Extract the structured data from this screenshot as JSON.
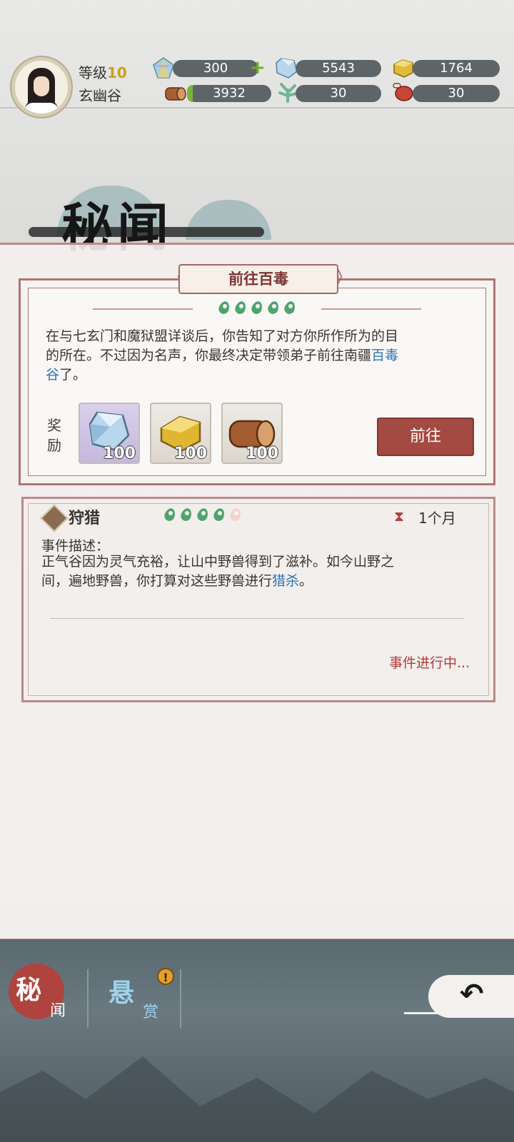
{
  "player": {
    "level_label": "等级",
    "level_value": "10",
    "sect_name": "玄幽谷"
  },
  "resources": [
    {
      "id": "spirit-stone",
      "icon": "rainbow-crystal-icon",
      "value": "300",
      "has_plus": true
    },
    {
      "id": "ore",
      "icon": "blue-ore-icon",
      "value": "5543"
    },
    {
      "id": "gold",
      "icon": "gold-ingot-icon",
      "value": "1764"
    },
    {
      "id": "wood",
      "icon": "wood-log-icon",
      "value": "3932",
      "fill_ratio": 0.05
    },
    {
      "id": "herb",
      "icon": "green-herb-icon",
      "value": "30"
    },
    {
      "id": "meat",
      "icon": "meat-icon",
      "value": "30"
    }
  ],
  "page": {
    "title": "秘闻"
  },
  "quest": {
    "title": "前往百毒",
    "rating": 5,
    "rating_max": 5,
    "desc_line1": "在与七玄门和魔狱盟详谈后，你告知了对方你所作所为的目",
    "desc_line2_a": "的所在。不过因为名声，你最终决定带领弟子前往南疆",
    "desc_line2_hl": "百毒",
    "desc_line3_hl": "谷",
    "desc_line3_b": "了。",
    "reward_label": "奖励",
    "rewards": [
      {
        "icon": "blue-ore-icon",
        "count": "100"
      },
      {
        "icon": "gold-ingot-icon",
        "count": "100"
      },
      {
        "icon": "wood-log-icon",
        "count": "100"
      }
    ],
    "go_button": "前往"
  },
  "event": {
    "name": "狩猎",
    "rating": 4,
    "rating_max": 5,
    "duration": "1个月",
    "desc_title": "事件描述：",
    "desc_line1": "正气谷因为灵气充裕，让山中野兽得到了滋补。如今山野之",
    "desc_line2_a": "间，遍地野兽，你打算对这些野兽进行",
    "desc_line2_hl": "猎杀",
    "desc_line2_b": "。",
    "status": "事件进行中..."
  },
  "nav": {
    "tab1_main": "秘",
    "tab1_sub": "闻",
    "tab2_main": "悬",
    "tab2_sub": "赏",
    "alert": "!",
    "back_icon": "back-arrow-icon"
  },
  "colors": {
    "accent_red": "#a34a42",
    "highlight_blue": "#2f73b5",
    "status_red": "#b23a3a",
    "rating_green": "#4fa36d",
    "level_gold": "#caa11a"
  }
}
